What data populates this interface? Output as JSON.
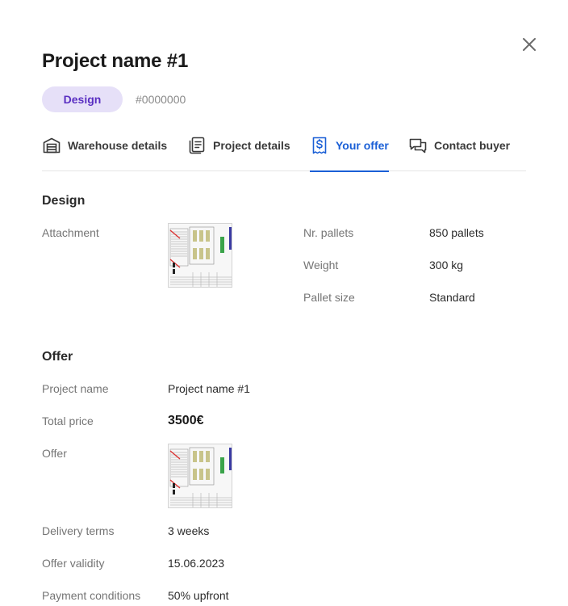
{
  "modal": {
    "title": "Project name #1",
    "badge": "Design",
    "project_id": "#0000000"
  },
  "tabs": [
    {
      "label": "Warehouse details",
      "icon": "warehouse-icon",
      "active": false
    },
    {
      "label": "Project details",
      "icon": "document-icon",
      "active": false
    },
    {
      "label": "Your offer",
      "icon": "dollar-receipt-icon",
      "active": true
    },
    {
      "label": "Contact buyer",
      "icon": "chat-icon",
      "active": false
    }
  ],
  "design": {
    "title": "Design",
    "attachment_label": "Attachment",
    "pallets_label": "Nr. pallets",
    "pallets_value": "850 pallets",
    "weight_label": "Weight",
    "weight_value": "300 kg",
    "pallet_size_label": "Pallet size",
    "pallet_size_value": "Standard"
  },
  "offer": {
    "title": "Offer",
    "project_name_label": "Project name",
    "project_name_value": "Project name #1",
    "total_price_label": "Total price",
    "total_price_value": "3500€",
    "offer_label": "Offer",
    "delivery_terms_label": "Delivery terms",
    "delivery_terms_value": "3 weeks",
    "offer_validity_label": "Offer validity",
    "offer_validity_value": "15.06.2023",
    "payment_conditions_label": "Payment conditions",
    "payment_conditions_value": "50% upfront"
  },
  "colors": {
    "accent": "#1a5fd6",
    "badge_bg": "#e6e0f8",
    "badge_text": "#5a2fc2"
  }
}
